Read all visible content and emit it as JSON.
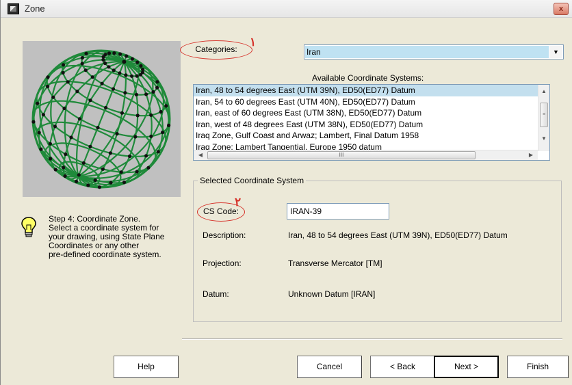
{
  "window": {
    "title": "Zone",
    "close_label": "x"
  },
  "colors": {
    "annotation_red": "#d6322a",
    "globe_green": "#1f8a3a",
    "selection_blue": "#c3dfee",
    "combo_fill": "#bfe2f2"
  },
  "annotations": {
    "mark_1": "۱",
    "mark_2": "۲"
  },
  "step": {
    "lines": [
      "Step 4:  Coordinate Zone.",
      "Select a coordinate system for",
      "your drawing, using State Plane",
      "Coordinates or any other",
      "pre-defined coordinate system."
    ]
  },
  "categories": {
    "label": "Categories:",
    "selected": "Iran"
  },
  "coordinate_systems": {
    "label": "Available Coordinate Systems:",
    "items": [
      "Iran, 48 to 54 degrees East (UTM 39N), ED50(ED77) Datum",
      "Iran, 54 to 60 degrees East (UTM 40N), ED50(ED77) Datum",
      "Iran, east of 60 degrees East (UTM 38N), ED50(ED77) Datum",
      "Iran, west of 48 degrees East (UTM 38N), ED50(ED77) Datum",
      "Iraq Zone, Gulf Coast and Arwaz; Lambert, Final Datum 1958",
      "Iraq Zone; Lambert Tangential, Europe 1950 datum"
    ],
    "selected_index": 0
  },
  "selected_cs": {
    "group_title": "Selected Coordinate System",
    "code_label": "CS Code:",
    "code_value": "IRAN-39",
    "description_label": "Description:",
    "description_value": "Iran, 48 to 54 degrees East (UTM 39N), ED50(ED77) Datum",
    "projection_label": "Projection:",
    "projection_value": "Transverse Mercator [TM]",
    "datum_label": "Datum:",
    "datum_value": "Unknown Datum [IRAN]"
  },
  "buttons": {
    "help": "Help",
    "cancel": "Cancel",
    "back": "< Back",
    "next": "Next >",
    "finish": "Finish"
  }
}
